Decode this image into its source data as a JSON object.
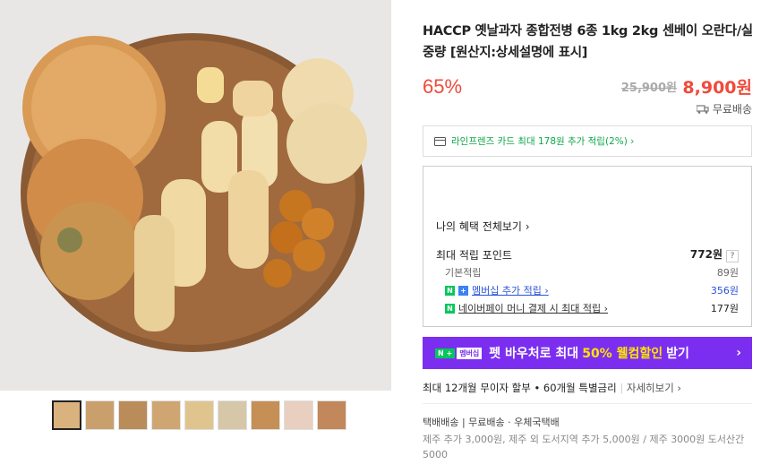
{
  "product": {
    "title": "HACCP 옛날과자 종합전병 6종 1kg 2kg 센베이 오란다/실중량 [원산지:상세설명에 표시]",
    "discount": "65%",
    "original_price": "25,900원",
    "price": "8,900원",
    "shipping": "무료배송"
  },
  "card_promo": "라인프렌즈 카드 최대 178원 추가 적립(2%) ›",
  "benefits": {
    "header": "나의 혜택 전체보기 ›",
    "rows": [
      {
        "label": "최대 적립 포인트",
        "value": "772원"
      },
      {
        "label": "기본적립",
        "value": "89원"
      },
      {
        "label": "멤버십 추가 적립 ›",
        "value": "356원"
      },
      {
        "label": "네이버페이 머니 결제 시 최대 적립 ›",
        "value": "177원"
      }
    ]
  },
  "banner": {
    "badge1": "N +",
    "badge2": "멤버십",
    "text_pre": "펫 바우처로 최대",
    "text_highlight": "50% 웰컴할인",
    "text_post": "받기",
    "chevron": "›"
  },
  "installment": "최대 12개월 무이자 할부 • 60개월 특별금리",
  "installment_more": "자세히보기 ›",
  "delivery": "택배배송 | 무료배송 · 우체국택배",
  "extra_fee": "제주 추가 3,000원, 제주 외 도서지역 추가 5,000원 / 제주 3000원 도서산간 5000",
  "colors": {
    "accent": "#f04a3b",
    "naver_green": "#03c75a",
    "banner": "#7c2ef0"
  },
  "icons": {
    "card": "credit-card-icon",
    "truck": "truck-icon"
  }
}
